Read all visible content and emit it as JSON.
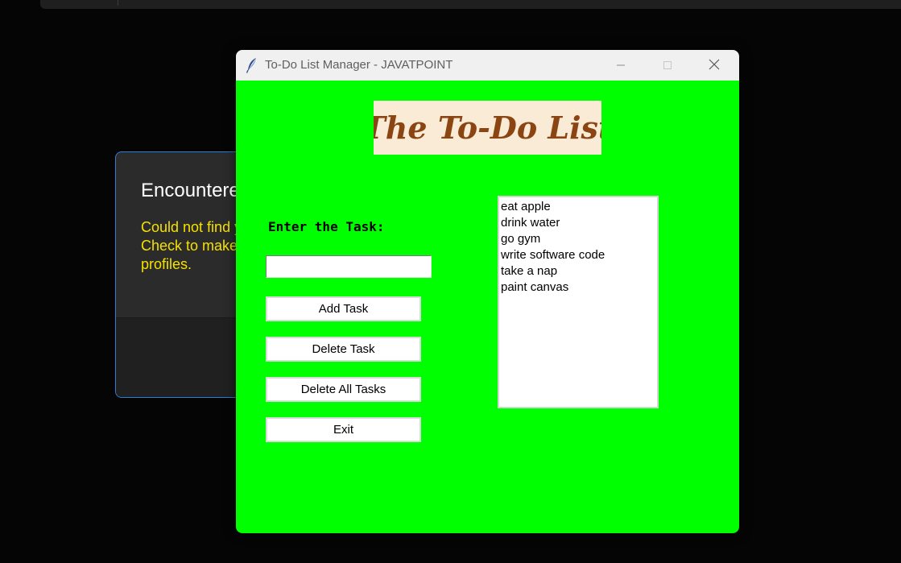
{
  "background_dialog": {
    "title": "Encountere",
    "message_lines": [
      "Could not find y",
      "Check to make",
      "profiles."
    ],
    "border_color": "#2f7dd6",
    "message_color": "#f5e100"
  },
  "window": {
    "title": "To-Do List Manager - JAVATPOINT",
    "icon": "tk-feather-icon",
    "controls": {
      "minimize": "minimize-icon",
      "maximize": "maximize-icon",
      "close": "close-icon"
    }
  },
  "app": {
    "background_color": "#00ff00",
    "banner_text": "The To-Do List",
    "banner_bg": "#faebd7",
    "banner_color": "#8b4513",
    "task_label": "Enter the Task:",
    "task_input_value": "",
    "buttons": {
      "add": "Add Task",
      "delete": "Delete Task",
      "delete_all": "Delete All Tasks",
      "exit": "Exit"
    },
    "tasks": [
      "eat apple",
      "drink water",
      "go gym",
      "write software code",
      "take a nap",
      "paint canvas"
    ]
  }
}
